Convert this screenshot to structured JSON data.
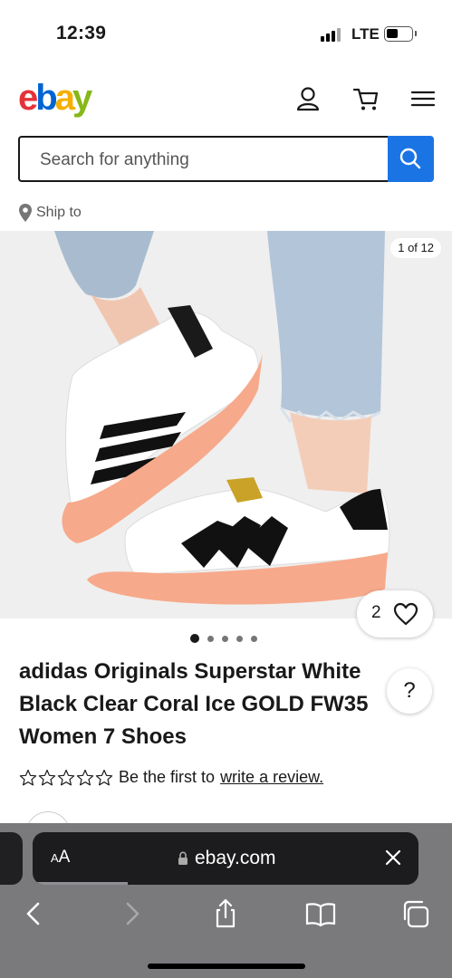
{
  "status_bar": {
    "time": "12:39",
    "network": "LTE",
    "icons": [
      "signal-icon",
      "battery-icon"
    ]
  },
  "header": {
    "logo": "ebay",
    "icons": [
      "account-icon",
      "cart-icon",
      "menu-icon"
    ]
  },
  "search": {
    "placeholder": "Search for anything",
    "button_icon": "search-icon"
  },
  "ship_to": {
    "label": "Ship to",
    "icon": "location-pin-icon"
  },
  "gallery": {
    "counter": "1 of 12",
    "current_index": 1,
    "total": 12,
    "visible_dots": 5,
    "watch_count": "2",
    "watch_icon": "heart-icon",
    "image_description_icon": "product-photo"
  },
  "listing": {
    "title_lines": [
      "adidas Originals Superstar White",
      "Black Clear Coral Ice GOLD FW35",
      "Women 7 Shoes"
    ],
    "help_label": "?",
    "rating_stars": 5,
    "rating_filled": 0,
    "review_prefix": "Be the first to",
    "review_link": "write a review."
  },
  "browser": {
    "text_size_label_small": "A",
    "text_size_label_large": "A",
    "url": "ebay.com",
    "icons": [
      "lock-icon",
      "close-icon",
      "back-icon",
      "forward-icon",
      "share-icon",
      "bookmarks-icon",
      "tabs-icon"
    ]
  },
  "colors": {
    "ebay_red": "#e53238",
    "ebay_blue": "#0064d2",
    "ebay_yellow": "#f5af02",
    "ebay_green": "#86b817",
    "search_blue": "#1b74e4",
    "coral_sole": "#f7a98b"
  }
}
